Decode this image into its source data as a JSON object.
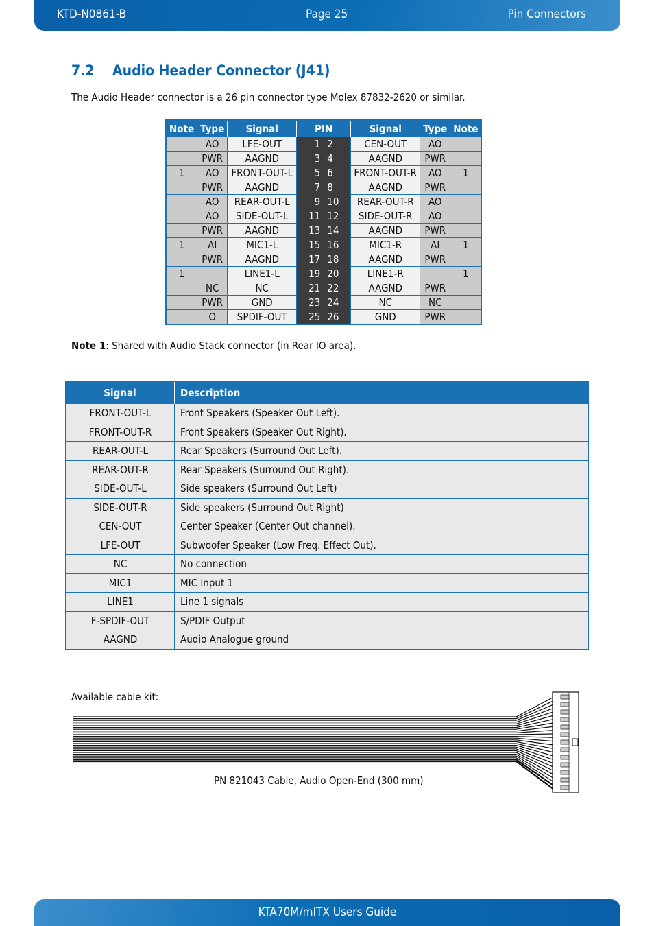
{
  "header": {
    "doc_id": "KTD-N0861-B",
    "page": "Page 25",
    "chapter": "Pin Connectors"
  },
  "section": {
    "number": "7.2",
    "title": "Audio Header Connector (J41)"
  },
  "intro": "The Audio Header connector is a 26 pin connector type Molex 87832-2620 or similar.",
  "pin_table": {
    "headers": [
      "Note",
      "Type",
      "Signal",
      "PIN",
      "Signal",
      "Type",
      "Note"
    ],
    "rows": [
      {
        "ln": "",
        "lt": "AO",
        "ls": "LFE-OUT",
        "lp": "1",
        "rp": "2",
        "rs": "CEN-OUT",
        "rt": "AO",
        "rn": ""
      },
      {
        "ln": "",
        "lt": "PWR",
        "ls": "AAGND",
        "lp": "3",
        "rp": "4",
        "rs": "AAGND",
        "rt": "PWR",
        "rn": ""
      },
      {
        "ln": "1",
        "lt": "AO",
        "ls": "FRONT-OUT-L",
        "lp": "5",
        "rp": "6",
        "rs": "FRONT-OUT-R",
        "rt": "AO",
        "rn": "1"
      },
      {
        "ln": "",
        "lt": "PWR",
        "ls": "AAGND",
        "lp": "7",
        "rp": "8",
        "rs": "AAGND",
        "rt": "PWR",
        "rn": ""
      },
      {
        "ln": "",
        "lt": "AO",
        "ls": "REAR-OUT-L",
        "lp": "9",
        "rp": "10",
        "rs": "REAR-OUT-R",
        "rt": "AO",
        "rn": ""
      },
      {
        "ln": "",
        "lt": "AO",
        "ls": "SIDE-OUT-L",
        "lp": "11",
        "rp": "12",
        "rs": "SIDE-OUT-R",
        "rt": "AO",
        "rn": ""
      },
      {
        "ln": "",
        "lt": "PWR",
        "ls": "AAGND",
        "lp": "13",
        "rp": "14",
        "rs": "AAGND",
        "rt": "PWR",
        "rn": ""
      },
      {
        "ln": "1",
        "lt": "AI",
        "ls": "MIC1-L",
        "lp": "15",
        "rp": "16",
        "rs": "MIC1-R",
        "rt": "AI",
        "rn": "1"
      },
      {
        "ln": "",
        "lt": "PWR",
        "ls": "AAGND",
        "lp": "17",
        "rp": "18",
        "rs": "AAGND",
        "rt": "PWR",
        "rn": ""
      },
      {
        "ln": "1",
        "lt": "",
        "ls": "LINE1-L",
        "lp": "19",
        "rp": "20",
        "rs": "LINE1-R",
        "rt": "",
        "rn": "1"
      },
      {
        "ln": "",
        "lt": "NC",
        "ls": "NC",
        "lp": "21",
        "rp": "22",
        "rs": "AAGND",
        "rt": "PWR",
        "rn": ""
      },
      {
        "ln": "",
        "lt": "PWR",
        "ls": "GND",
        "lp": "23",
        "rp": "24",
        "rs": "NC",
        "rt": "NC",
        "rn": ""
      },
      {
        "ln": "",
        "lt": "O",
        "ls": "SPDIF-OUT",
        "lp": "25",
        "rp": "26",
        "rs": "GND",
        "rt": "PWR",
        "rn": ""
      }
    ]
  },
  "note1": {
    "label": "Note 1",
    "text": ": Shared with Audio Stack connector (in Rear IO area)."
  },
  "desc_table": {
    "headers": [
      "Signal",
      "Description"
    ],
    "rows": [
      [
        "FRONT-OUT-L",
        "Front Speakers (Speaker Out Left)."
      ],
      [
        "FRONT-OUT-R",
        "Front Speakers (Speaker Out Right)."
      ],
      [
        "REAR-OUT-L",
        "Rear Speakers (Surround Out Left)."
      ],
      [
        "REAR-OUT-R",
        "Rear Speakers (Surround Out Right)."
      ],
      [
        "SIDE-OUT-L",
        "Side speakers (Surround Out Left)"
      ],
      [
        "SIDE-OUT-R",
        "Side speakers (Surround Out Right)"
      ],
      [
        "CEN-OUT",
        "Center Speaker (Center Out channel)."
      ],
      [
        "LFE-OUT",
        "Subwoofer Speaker (Low Freq. Effect Out)."
      ],
      [
        "NC",
        "No connection"
      ],
      [
        "MIC1",
        "MIC Input 1"
      ],
      [
        "LINE1",
        "Line 1 signals"
      ],
      [
        "F-SPDIF-OUT",
        "S/PDIF Output"
      ],
      [
        "AAGND",
        "Audio Analogue ground"
      ]
    ]
  },
  "cable": {
    "label": "Available cable kit:",
    "caption": "PN 821043 Cable, Audio Open-End (300 mm)"
  },
  "footer": {
    "title": "KTA70M/mITX Users Guide"
  },
  "colors": {
    "brand_blue": "#1a72b4",
    "heading_blue": "#0a64ae",
    "pin_dark": "#3c3c3c"
  }
}
